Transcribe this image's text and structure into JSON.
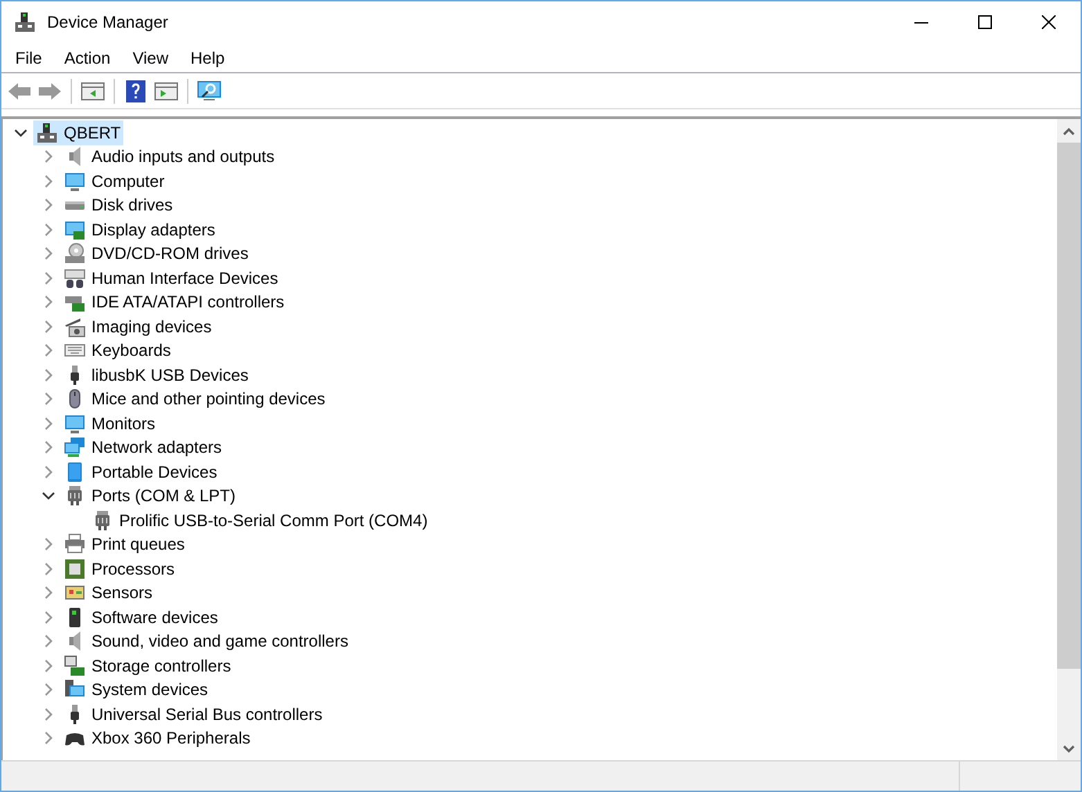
{
  "window": {
    "title": "Device Manager"
  },
  "menu": [
    "File",
    "Action",
    "View",
    "Help"
  ],
  "tree": {
    "label": "QBERT",
    "kind": "computer",
    "expanded": true,
    "selected": true,
    "children": [
      {
        "label": "Audio inputs and outputs",
        "kind": "speaker",
        "expanded": false
      },
      {
        "label": "Computer",
        "kind": "monitor",
        "expanded": false
      },
      {
        "label": "Disk drives",
        "kind": "disk",
        "expanded": false
      },
      {
        "label": "Display adapters",
        "kind": "display",
        "expanded": false
      },
      {
        "label": "DVD/CD-ROM drives",
        "kind": "dvd",
        "expanded": false
      },
      {
        "label": "Human Interface Devices",
        "kind": "hid",
        "expanded": false
      },
      {
        "label": "IDE ATA/ATAPI controllers",
        "kind": "ide",
        "expanded": false
      },
      {
        "label": "Imaging devices",
        "kind": "camera",
        "expanded": false
      },
      {
        "label": "Keyboards",
        "kind": "keyboard",
        "expanded": false
      },
      {
        "label": "libusbK USB Devices",
        "kind": "usb",
        "expanded": false
      },
      {
        "label": "Mice and other pointing devices",
        "kind": "mouse",
        "expanded": false
      },
      {
        "label": "Monitors",
        "kind": "monitor",
        "expanded": false
      },
      {
        "label": "Network adapters",
        "kind": "network",
        "expanded": false
      },
      {
        "label": "Portable Devices",
        "kind": "portable",
        "expanded": false
      },
      {
        "label": "Ports (COM & LPT)",
        "kind": "port",
        "expanded": true,
        "children": [
          {
            "label": "Prolific USB-to-Serial Comm Port (COM4)",
            "kind": "port"
          }
        ]
      },
      {
        "label": "Print queues",
        "kind": "printer",
        "expanded": false
      },
      {
        "label": "Processors",
        "kind": "cpu",
        "expanded": false
      },
      {
        "label": "Sensors",
        "kind": "sensor",
        "expanded": false
      },
      {
        "label": "Software devices",
        "kind": "software",
        "expanded": false
      },
      {
        "label": "Sound, video and game controllers",
        "kind": "speaker",
        "expanded": false
      },
      {
        "label": "Storage controllers",
        "kind": "storage",
        "expanded": false
      },
      {
        "label": "System devices",
        "kind": "system",
        "expanded": false
      },
      {
        "label": "Universal Serial Bus controllers",
        "kind": "usb",
        "expanded": false
      },
      {
        "label": "Xbox 360 Peripherals",
        "kind": "gamepad",
        "expanded": false
      }
    ]
  }
}
